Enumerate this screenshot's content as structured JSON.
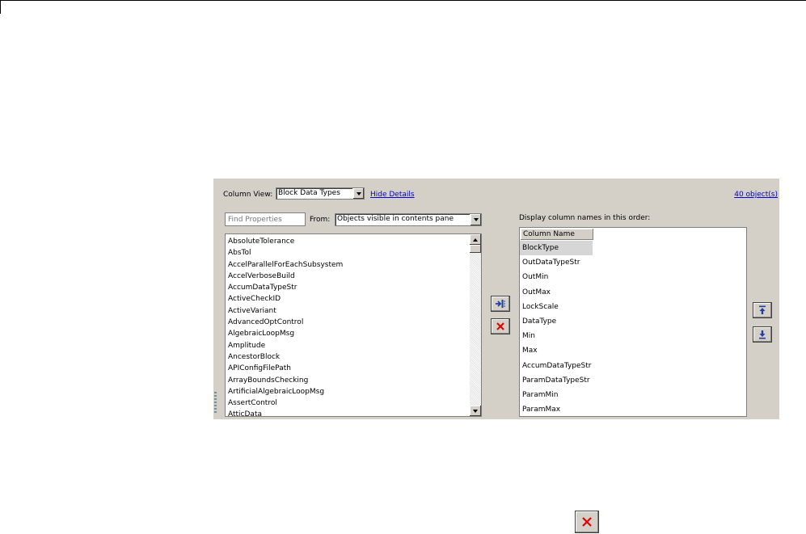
{
  "toolbar": {
    "column_view_label": "Column View:",
    "column_view_value": "Block Data Types",
    "hide_details_link": "Hide Details",
    "object_count_link": "40 object(s)"
  },
  "properties": {
    "find_placeholder": "Find Properties",
    "from_label": "From:",
    "from_value": "Objects visible in contents pane",
    "items": [
      "AbsoluteTolerance",
      "AbsTol",
      "AccelParallelForEachSubsystem",
      "AccelVerboseBuild",
      "AccumDataTypeStr",
      "ActiveCheckID",
      "ActiveVariant",
      "AdvancedOptControl",
      "AlgebraicLoopMsg",
      "Amplitude",
      "AncestorBlock",
      "APIConfigFilePath",
      "ArrayBoundsChecking",
      "ArtificialAlgebraicLoopMsg",
      "AssertControl",
      "AtticData"
    ]
  },
  "column_order": {
    "heading": "Display column names in this order:",
    "header": "Column Name",
    "selected": "BlockType",
    "items": [
      "BlockType",
      "OutDataTypeStr",
      "OutMin",
      "OutMax",
      "LockScale",
      "DataType",
      "Min",
      "Max",
      "AccumDataTypeStr",
      "ParamDataTypeStr",
      "ParamMin",
      "ParamMax"
    ]
  },
  "icons": {
    "add": "add-column-icon",
    "remove": "remove-column-icon",
    "move_up": "move-up-icon",
    "move_down": "move-down-icon"
  },
  "colors": {
    "panel_bg": "#d4d0c8",
    "link": "#0000cc",
    "delete_red": "#e00000",
    "arrow_blue": "#1f3fa8"
  }
}
